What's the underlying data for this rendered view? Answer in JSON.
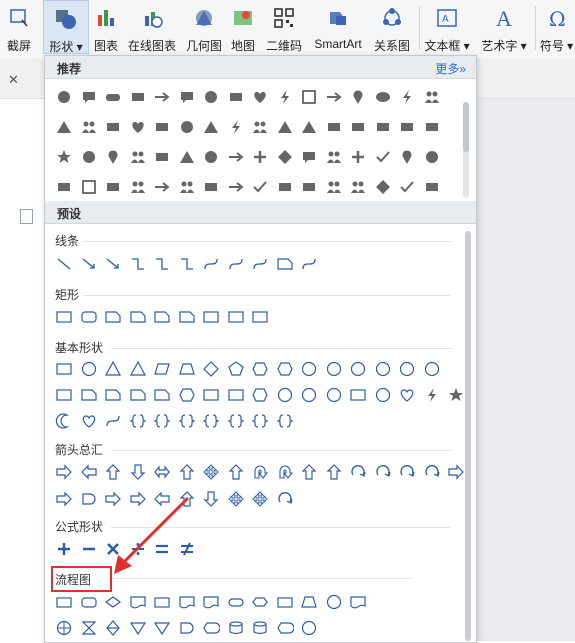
{
  "ribbon": {
    "buttons": [
      {
        "label": "截屏",
        "icon": "screenshot-icon"
      },
      {
        "label": "形状",
        "icon": "shapes-icon",
        "active": true
      },
      {
        "label": "图表",
        "icon": "chart-icon"
      },
      {
        "label": "在线图表",
        "icon": "online-chart-icon"
      },
      {
        "label": "几何图",
        "icon": "geometry-icon"
      },
      {
        "label": "地图",
        "icon": "map-icon"
      },
      {
        "label": "二维码",
        "icon": "qrcode-icon"
      },
      {
        "label": "SmartArt",
        "icon": "smartart-icon"
      },
      {
        "label": "关系图",
        "icon": "relation-icon"
      },
      {
        "label": "文本框",
        "icon": "textbox-icon"
      },
      {
        "label": "艺术字",
        "icon": "wordart-icon"
      },
      {
        "label": "符号",
        "icon": "symbol-icon"
      }
    ]
  },
  "panel": {
    "recommended": {
      "title": "推荐",
      "more": "更多»"
    },
    "presets": {
      "title": "预设"
    },
    "sections": [
      {
        "title": "线条"
      },
      {
        "title": "矩形"
      },
      {
        "title": "基本形状"
      },
      {
        "title": "箭头总汇"
      },
      {
        "title": "公式形状"
      },
      {
        "title": "流程图"
      }
    ]
  },
  "colors": {
    "accent": "#3c64b4",
    "highlight": "#e0302c",
    "shape_fill": "#666666",
    "shape_outline": "#2f5da6"
  }
}
